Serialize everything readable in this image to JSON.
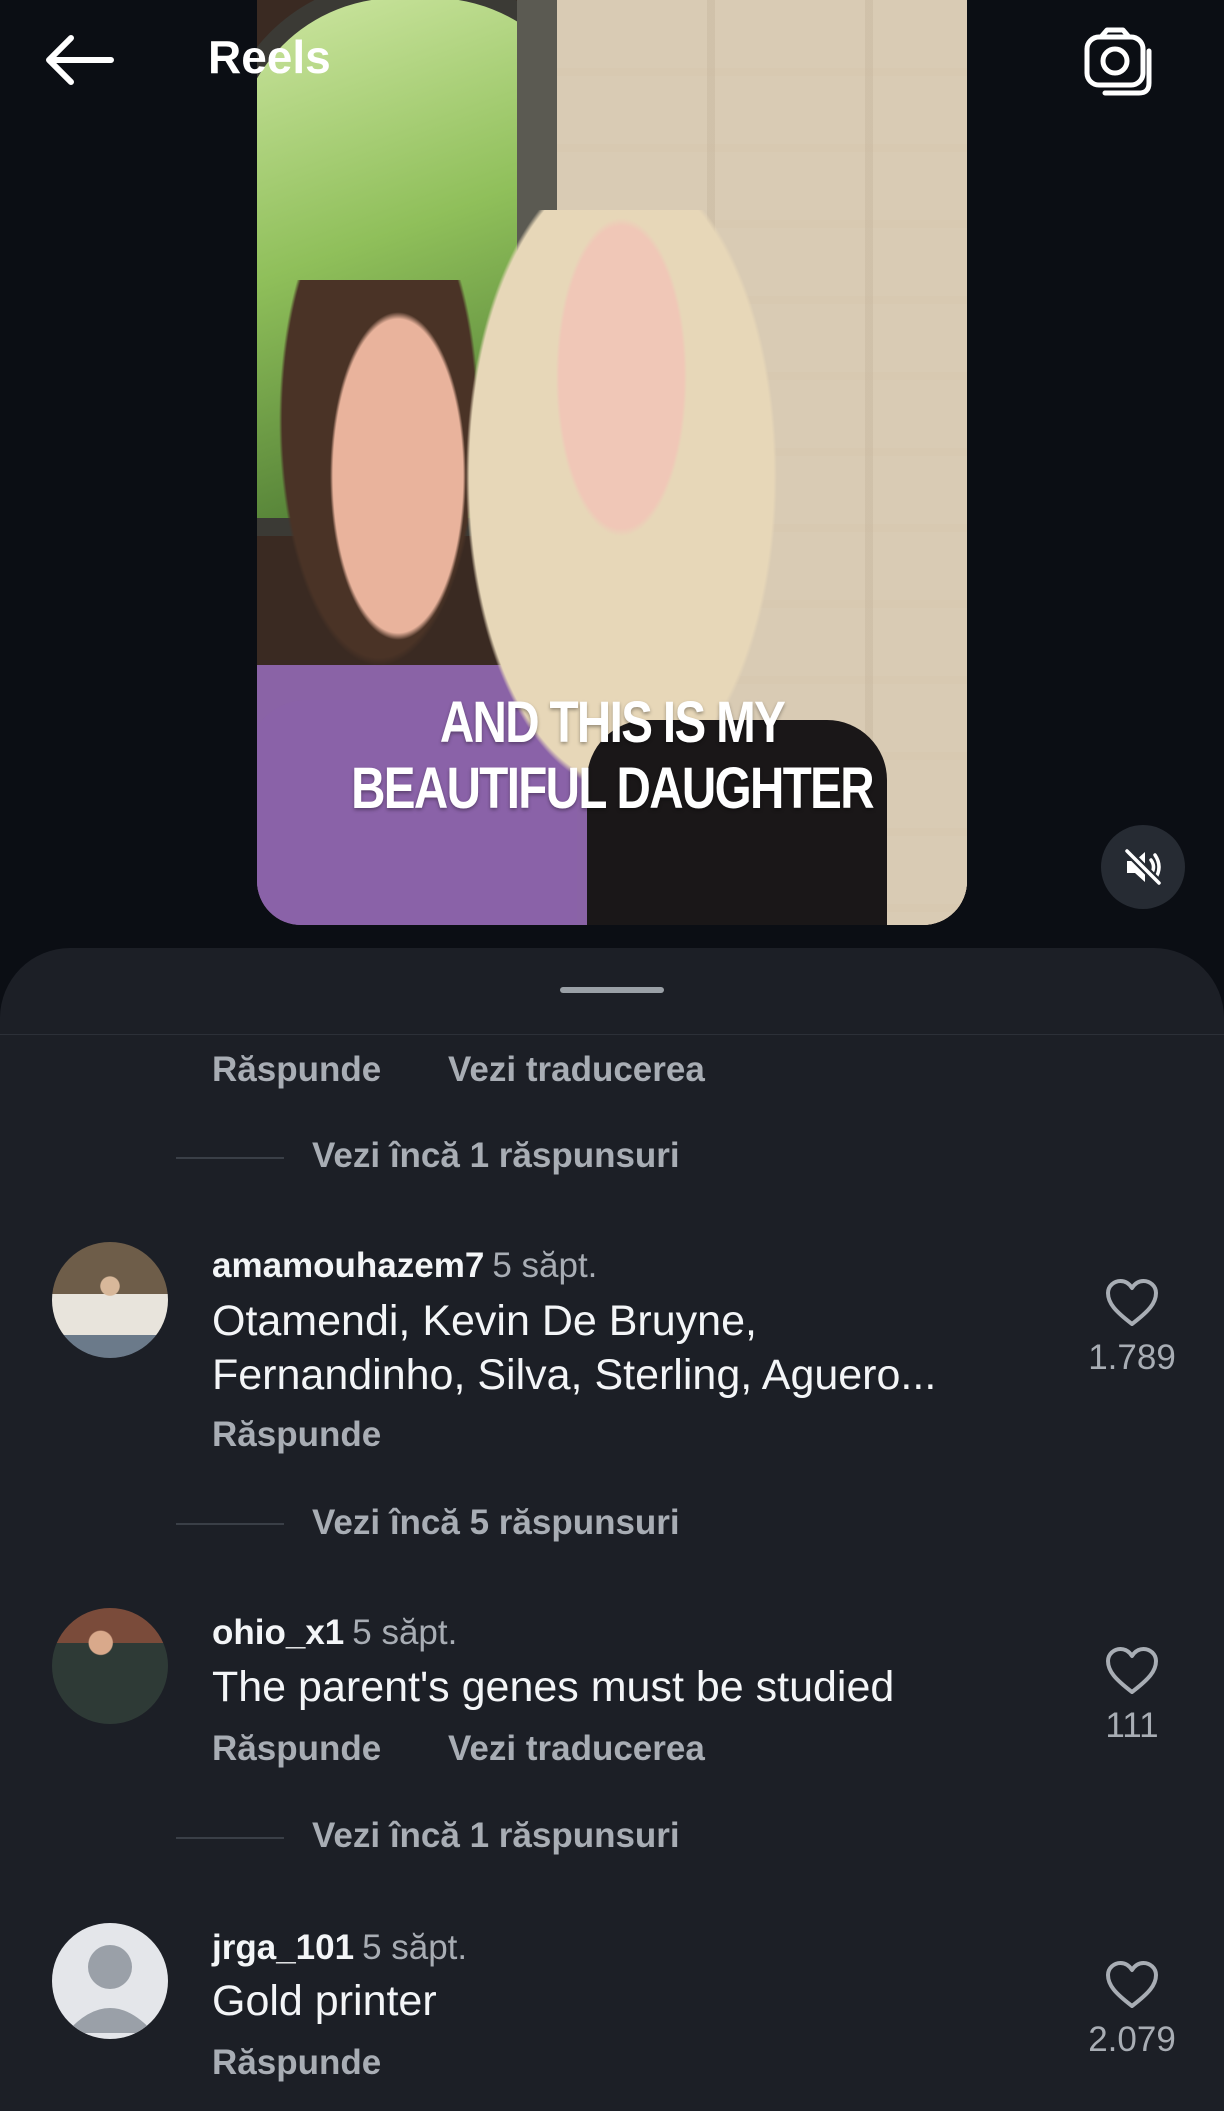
{
  "header": {
    "title": "Reels"
  },
  "video": {
    "caption_line1": "AND THIS IS MY",
    "caption_line2": "BEAUTIFUL DAUGHTER"
  },
  "comments_sheet": {
    "top_actions": {
      "reply": "Răspunde",
      "translate": "Vezi traducerea"
    },
    "top_more_replies": "Vezi încă 1 răspunsuri",
    "comments": [
      {
        "username": "amamouhazem7",
        "time": "5 săpt.",
        "text_line1": "Otamendi, Kevin De Bruyne,",
        "text_line2": "Fernandinho, Silva, Sterling, Aguero...",
        "reply": "Răspunde",
        "likes": "1.789",
        "more_replies": "Vezi încă 5 răspunsuri"
      },
      {
        "username": "ohio_x1",
        "time": "5 săpt.",
        "text_line1": "The parent's genes must be studied",
        "reply": "Răspunde",
        "translate": "Vezi traducerea",
        "likes": "111",
        "more_replies": "Vezi încă 1 răspunsuri"
      },
      {
        "username": "jrga_101",
        "time": "5 săpt.",
        "text_line1": "Gold printer",
        "reply": "Răspunde",
        "likes": "2.079"
      }
    ]
  },
  "icons": {
    "back": "arrow-left-icon",
    "camera": "camera-icon",
    "mute": "muted-speaker-icon",
    "like": "heart-outline-icon"
  }
}
